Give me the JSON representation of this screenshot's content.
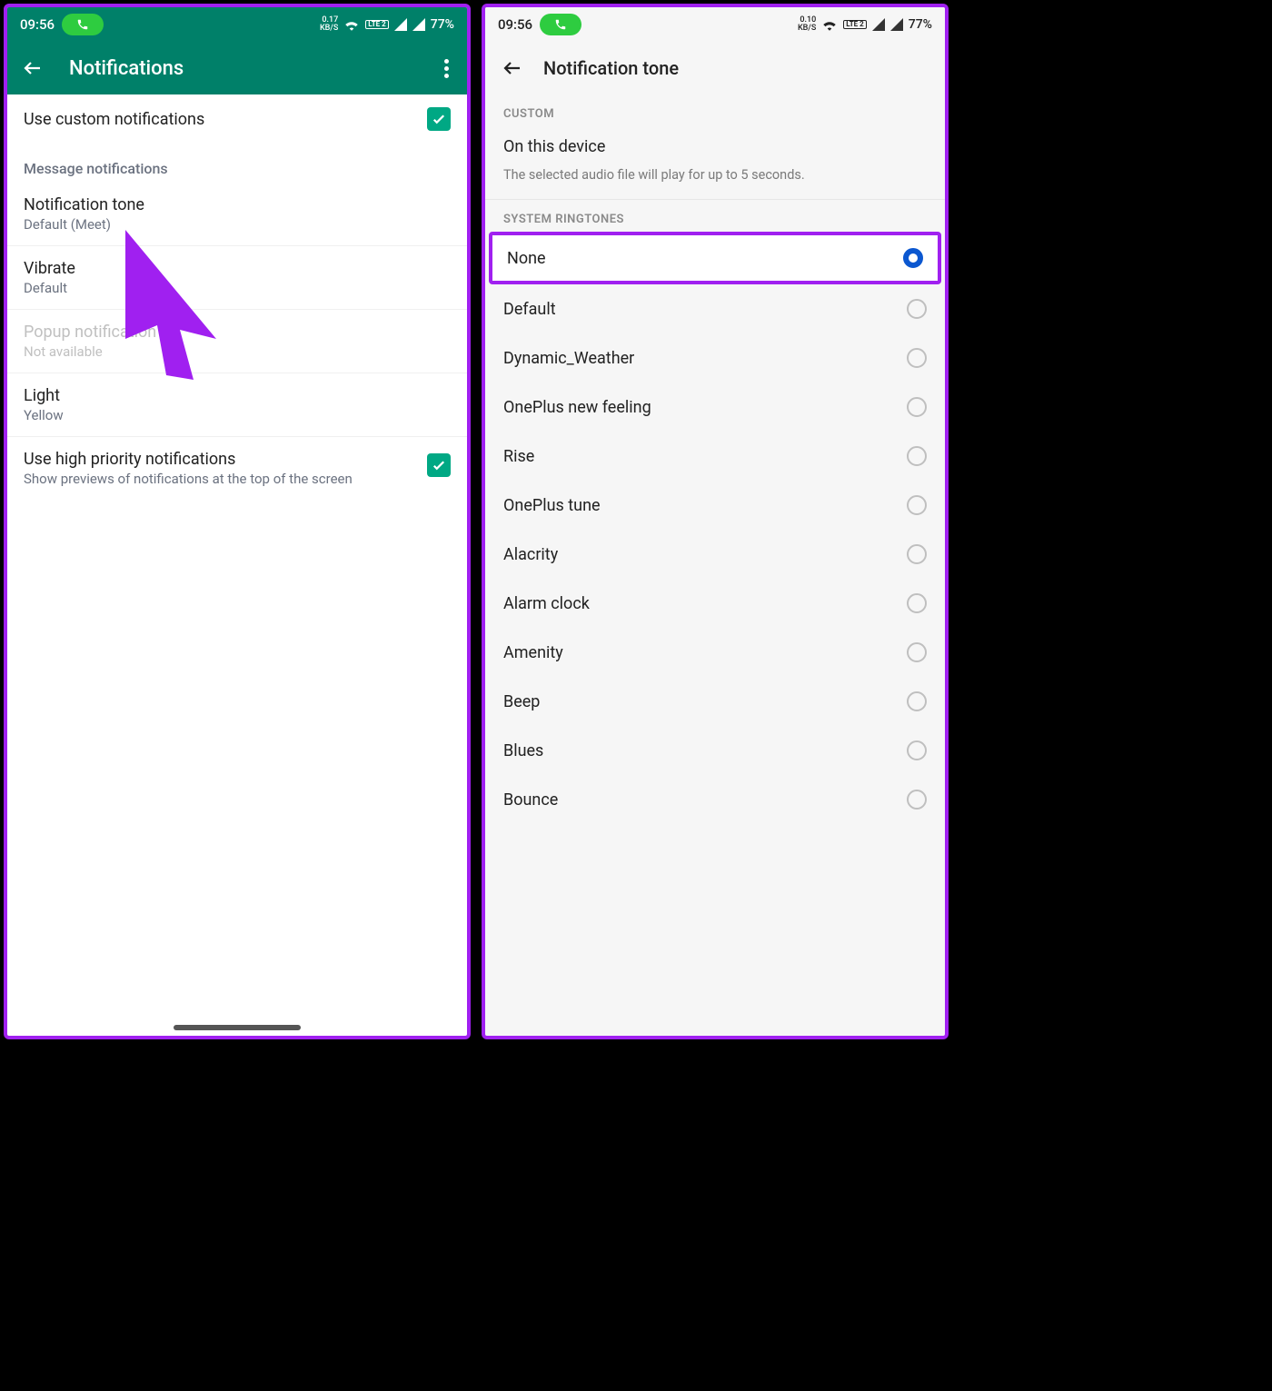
{
  "status": {
    "time": "09:56",
    "kbs_left": "0.17",
    "kbs_right": "0.10",
    "kbs_unit": "KB/S",
    "lte_label": "LTE 2",
    "battery": "77%"
  },
  "left": {
    "title": "Notifications",
    "useCustom": {
      "label": "Use custom notifications",
      "checked": true
    },
    "sectionHeader": "Message notifications",
    "items": [
      {
        "title": "Notification tone",
        "sub": "Default (Meet)",
        "disabled": false
      },
      {
        "title": "Vibrate",
        "sub": "Default",
        "disabled": false
      },
      {
        "title": "Popup notification",
        "sub": "Not available",
        "disabled": true
      },
      {
        "title": "Light",
        "sub": "Yellow",
        "disabled": false
      }
    ],
    "highPriority": {
      "title": "Use high priority notifications",
      "sub": "Show previews of notifications at the top of the screen",
      "checked": true
    }
  },
  "right": {
    "title": "Notification tone",
    "customHeader": "CUSTOM",
    "customItem": "On this device",
    "customDesc": "The selected audio file will play for up to 5 seconds.",
    "ringtonesHeader": "SYSTEM RINGTONES",
    "ringtones": [
      {
        "label": "None",
        "selected": true,
        "highlight": true
      },
      {
        "label": "Default",
        "selected": false
      },
      {
        "label": "Dynamic_Weather",
        "selected": false
      },
      {
        "label": "OnePlus new feeling",
        "selected": false
      },
      {
        "label": "Rise",
        "selected": false
      },
      {
        "label": "OnePlus tune",
        "selected": false
      },
      {
        "label": "Alacrity",
        "selected": false
      },
      {
        "label": "Alarm clock",
        "selected": false
      },
      {
        "label": "Amenity",
        "selected": false
      },
      {
        "label": "Beep",
        "selected": false
      },
      {
        "label": "Blues",
        "selected": false
      },
      {
        "label": "Bounce",
        "selected": false
      }
    ]
  }
}
